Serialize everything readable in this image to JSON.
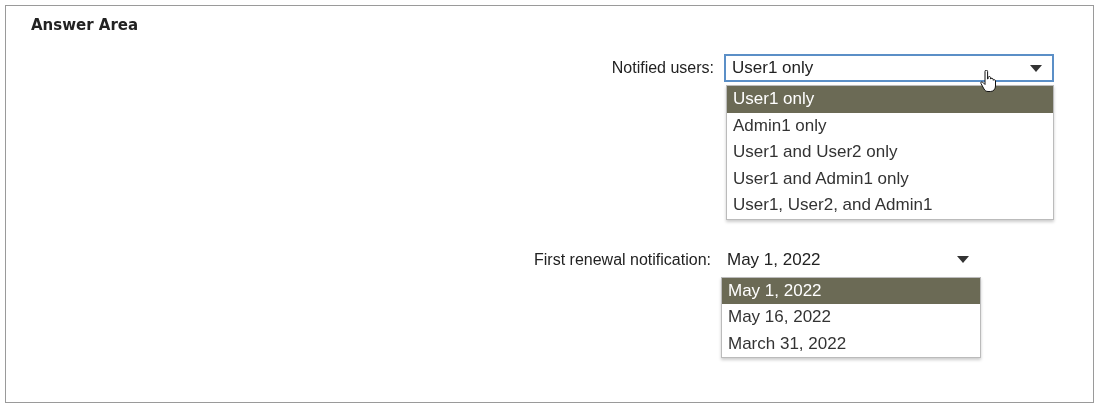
{
  "title": "Answer Area",
  "dropdowns": [
    {
      "label": "Notified users:",
      "value": "User1 only",
      "focused": true,
      "options": [
        {
          "label": "User1 only",
          "selected": true
        },
        {
          "label": "Admin1 only",
          "selected": false
        },
        {
          "label": "User1 and User2 only",
          "selected": false
        },
        {
          "label": "User1 and Admin1 only",
          "selected": false
        },
        {
          "label": "User1, User2, and Admin1",
          "selected": false
        }
      ]
    },
    {
      "label": "First renewal notification:",
      "value": "May 1, 2022",
      "focused": false,
      "options": [
        {
          "label": "May 1, 2022",
          "selected": true
        },
        {
          "label": "May 16, 2022",
          "selected": false
        },
        {
          "label": "March 31, 2022",
          "selected": false
        }
      ]
    }
  ]
}
